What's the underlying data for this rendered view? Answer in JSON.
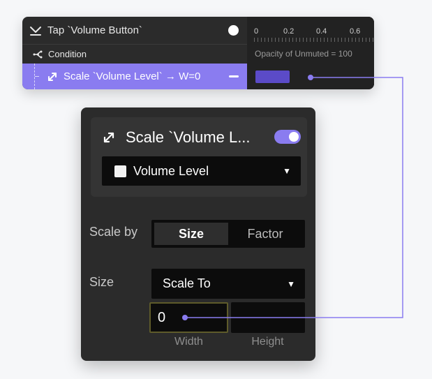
{
  "timeline": {
    "row1_label": "Tap `Volume Button`",
    "row2_label": "Condition",
    "row3_label": "Scale `Volume Level` → W=0",
    "ticks": [
      "0",
      "0.2",
      "0.4",
      "0.6"
    ],
    "opacity_text": "Opacity of Unmuted = 100"
  },
  "panel": {
    "title": "Scale `Volume L...",
    "layer_name": "Volume Level",
    "scale_by_label": "Scale by",
    "scale_by_options": [
      "Size",
      "Factor"
    ],
    "scale_by_selected": "Size",
    "size_label": "Size",
    "scale_mode": "Scale To",
    "width_value": "0",
    "height_value": "",
    "width_label": "Width",
    "height_label": "Height"
  },
  "colors": {
    "accent": "#8a7cf0",
    "bar": "#5b4bc8",
    "panel_bg": "#2b2b2b",
    "field_bg": "#0c0c0c"
  },
  "icons": [
    "tap-icon",
    "condition-icon",
    "scale-icon",
    "dropdown-caret-icon",
    "toggle-switch",
    "remove-icon"
  ]
}
